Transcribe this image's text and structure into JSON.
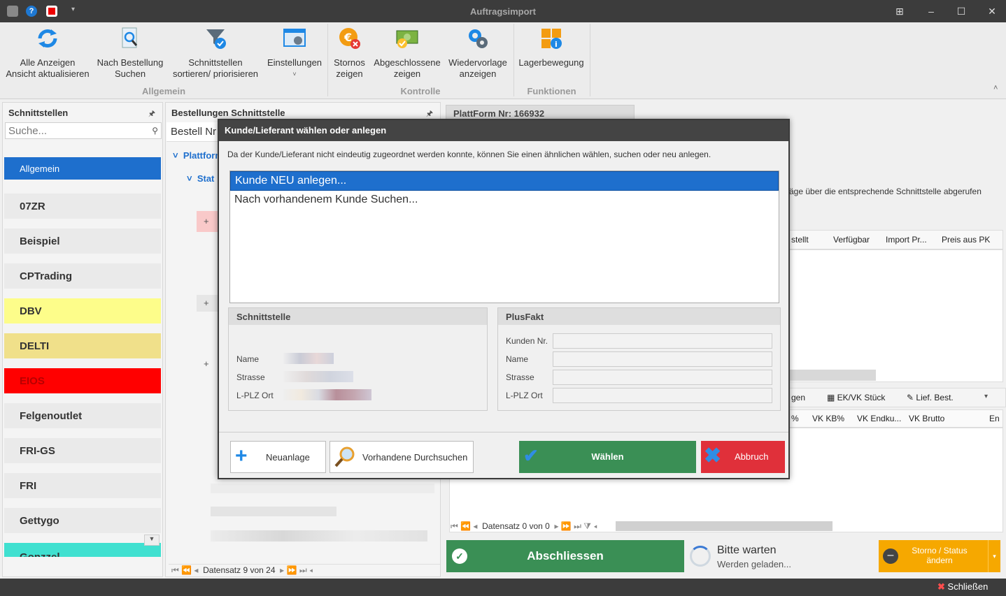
{
  "window": {
    "title": "Auftragsimport"
  },
  "ribbon": {
    "buttons": [
      {
        "line1": "Alle Anzeigen",
        "line2": "Ansicht aktualisieren"
      },
      {
        "line1": "Nach Bestellung",
        "line2": "Suchen"
      },
      {
        "line1": "Schnittstellen",
        "line2": "sortieren/ priorisieren"
      },
      {
        "line1": "Einstellungen",
        "line2": "˅"
      },
      {
        "line1": "Stornos",
        "line2": "zeigen"
      },
      {
        "line1": "Abgeschlossene",
        "line2": "zeigen"
      },
      {
        "line1": "Wiedervorlage",
        "line2": "anzeigen"
      },
      {
        "line1": "Lagerbewegung",
        "line2": ""
      }
    ],
    "groups": [
      "Allgemein",
      "Kontrolle",
      "Funktionen"
    ]
  },
  "left": {
    "title": "Schnittstellen",
    "search_placeholder": "Suche...",
    "items": [
      {
        "label": "Allgemein",
        "color": "#1e6fcd"
      },
      {
        "label": "07ZR",
        "color": "#eaeaea"
      },
      {
        "label": "Beispiel",
        "color": "#eaeaea"
      },
      {
        "label": "CPTrading",
        "color": "#eaeaea"
      },
      {
        "label": "DBV",
        "color": "#fdfd8a"
      },
      {
        "label": "DELTI",
        "color": "#f0e08a"
      },
      {
        "label": "EIOS",
        "color": "#ff0000"
      },
      {
        "label": "Felgenoutlet",
        "color": "#eaeaea"
      },
      {
        "label": "FRI-GS",
        "color": "#eaeaea"
      },
      {
        "label": "FRI",
        "color": "#eaeaea"
      },
      {
        "label": "Gettygo",
        "color": "#eaeaea"
      },
      {
        "label": "Gonzzel",
        "color": "#40e0d0"
      }
    ]
  },
  "middle": {
    "title": "Bestellungen Schnittstelle",
    "column": "Bestell Nr",
    "group1": "Plattform",
    "group2": "Stat",
    "status": "Datensatz 9 von 24"
  },
  "right": {
    "tab": "PlattForm Nr: 166932",
    "hint": "äge über die entsprechende Schnittstelle abgerufen",
    "columns": [
      "stellt",
      "Verfügbar",
      "Import Pr...",
      "Preis aus PK"
    ],
    "tabs2": [
      "gen",
      "EK/VK Stück",
      "Lief. Best."
    ],
    "columns2": [
      "%",
      "VK KB%",
      "VK Endku...",
      "VK Brutto",
      "En"
    ],
    "status": "Datensatz 0 von 0"
  },
  "bottom": {
    "finish": "Abschliessen",
    "wait_title": "Bitte warten",
    "wait_sub": "Werden geladen...",
    "storno_line1": "Storno / Status",
    "storno_line2": "ändern",
    "close": "Schließen"
  },
  "dialog": {
    "title": "Kunde/Lieferant wählen oder anlegen",
    "info": "Da der Kunde/Lieferant nicht eindeutig zugeordnet werden konnte, können Sie einen ähnlichen wählen, suchen oder neu anlegen.",
    "options": [
      "Kunde NEU anlegen...",
      "Nach vorhandenem Kunde Suchen..."
    ],
    "left_group": {
      "title": "Schnittstelle",
      "labels": [
        "Name",
        "Strasse",
        "L-PLZ Ort"
      ]
    },
    "right_group": {
      "title": "PlusFakt",
      "labels": [
        "Kunden Nr.",
        "Name",
        "Strasse",
        "L-PLZ Ort"
      ]
    },
    "buttons": {
      "new": "Neuanlage",
      "search": "Vorhandene Durchsuchen",
      "choose": "Wählen",
      "cancel": "Abbruch"
    }
  }
}
